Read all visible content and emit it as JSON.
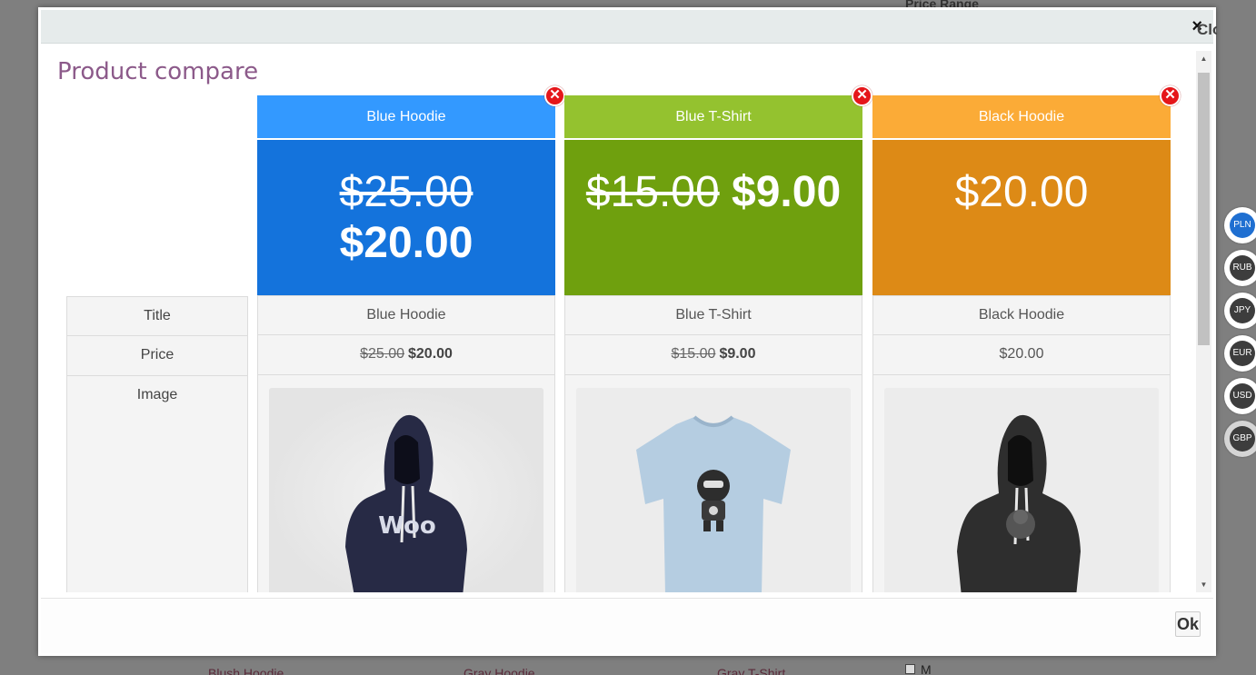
{
  "background": {
    "price_range_label": "Price Range",
    "products": [
      "Blush Hoodie",
      "Gray Hoodie",
      "Gray T-Shirt"
    ],
    "size_option": "M"
  },
  "modal": {
    "close_label": "Close",
    "heading": "Product compare",
    "ok_label": "Ok",
    "row_labels": {
      "title": "Title",
      "price": "Price",
      "image": "Image"
    },
    "products": [
      {
        "name": "Blue Hoodie",
        "header_color": "#3399ff",
        "price_bg_color": "#1473dc",
        "old_price": "$25.00",
        "price": "$20.00",
        "on_sale": true
      },
      {
        "name": "Blue T-Shirt",
        "header_color": "#94c22f",
        "price_bg_color": "#6fa00e",
        "old_price": "$15.00",
        "price": "$9.00",
        "on_sale": true
      },
      {
        "name": "Black Hoodie",
        "header_color": "#fbab37",
        "price_bg_color": "#dd8a16",
        "old_price": "",
        "price": "$20.00",
        "on_sale": false
      }
    ]
  },
  "currencies": [
    {
      "code": "PLN",
      "active": true
    },
    {
      "code": "RUB",
      "active": false
    },
    {
      "code": "JPY",
      "active": false
    },
    {
      "code": "EUR",
      "active": false
    },
    {
      "code": "USD",
      "active": false
    },
    {
      "code": "GBP",
      "active": false
    }
  ]
}
